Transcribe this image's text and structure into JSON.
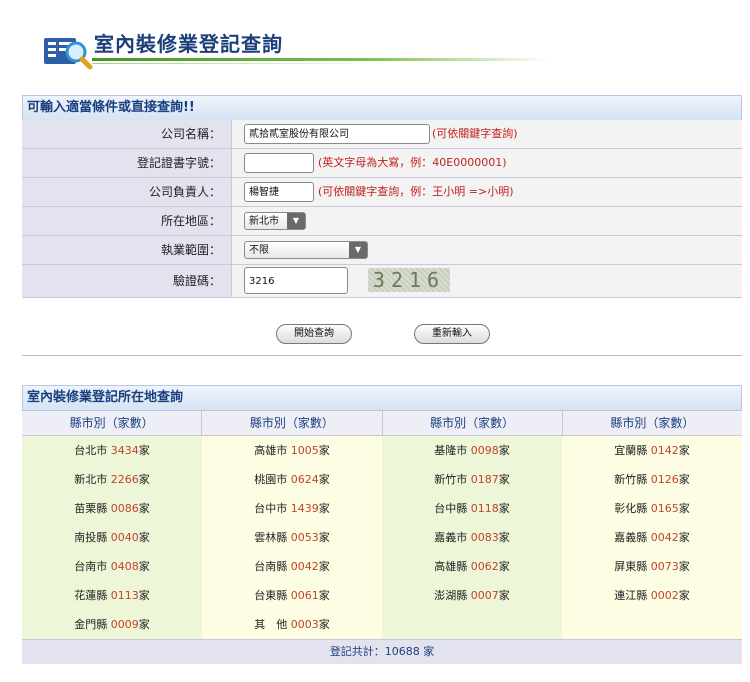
{
  "header": {
    "title": "室內裝修業登記查詢",
    "icon": "search-document-icon"
  },
  "form": {
    "section_title": "可輸入適當條件或直接查詢!!",
    "company_name": {
      "label": "公司名稱：",
      "value": "貳拾貳室股份有限公司",
      "note": "(可依關鍵字查詢)"
    },
    "cert_no": {
      "label": "登記證書字號：",
      "value": "",
      "note": "(英文字母為大寫，例：40E0000001)"
    },
    "owner": {
      "label": "公司負責人：",
      "value": "楊智捷",
      "note": "(可依關鍵字查詢，例：王小明 =>小明)"
    },
    "region": {
      "label": "所在地區：",
      "selected": "新北市"
    },
    "scope": {
      "label": "執業範圍：",
      "selected": "不限"
    },
    "captcha": {
      "label": "驗證碼：",
      "value": "3216",
      "image_text": "3216"
    }
  },
  "buttons": {
    "search": "開始查詢",
    "reset": "重新輸入"
  },
  "county": {
    "section_title": "室內裝修業登記所在地查詢",
    "header": "縣市別（家數）",
    "unit": "家",
    "columns": [
      [
        {
          "name": "台北市",
          "count": "3434"
        },
        {
          "name": "新北市",
          "count": "2266"
        },
        {
          "name": "苗栗縣",
          "count": "0086"
        },
        {
          "name": "南投縣",
          "count": "0040"
        },
        {
          "name": "台南市",
          "count": "0408"
        },
        {
          "name": "花蓮縣",
          "count": "0113"
        },
        {
          "name": "金門縣",
          "count": "0009"
        }
      ],
      [
        {
          "name": "高雄市",
          "count": "1005"
        },
        {
          "name": "桃園市",
          "count": "0624"
        },
        {
          "name": "台中市",
          "count": "1439"
        },
        {
          "name": "雲林縣",
          "count": "0053"
        },
        {
          "name": "台南縣",
          "count": "0042"
        },
        {
          "name": "台東縣",
          "count": "0061"
        },
        {
          "name": "其　他",
          "count": "0003"
        }
      ],
      [
        {
          "name": "基隆市",
          "count": "0098"
        },
        {
          "name": "新竹市",
          "count": "0187"
        },
        {
          "name": "台中縣",
          "count": "0118"
        },
        {
          "name": "嘉義市",
          "count": "0083"
        },
        {
          "name": "高雄縣",
          "count": "0062"
        },
        {
          "name": "澎湖縣",
          "count": "0007"
        }
      ],
      [
        {
          "name": "宜蘭縣",
          "count": "0142"
        },
        {
          "name": "新竹縣",
          "count": "0126"
        },
        {
          "name": "彰化縣",
          "count": "0165"
        },
        {
          "name": "嘉義縣",
          "count": "0042"
        },
        {
          "name": "屏東縣",
          "count": "0073"
        },
        {
          "name": "連江縣",
          "count": "0002"
        }
      ]
    ],
    "total": "登記共計：10688 家"
  }
}
